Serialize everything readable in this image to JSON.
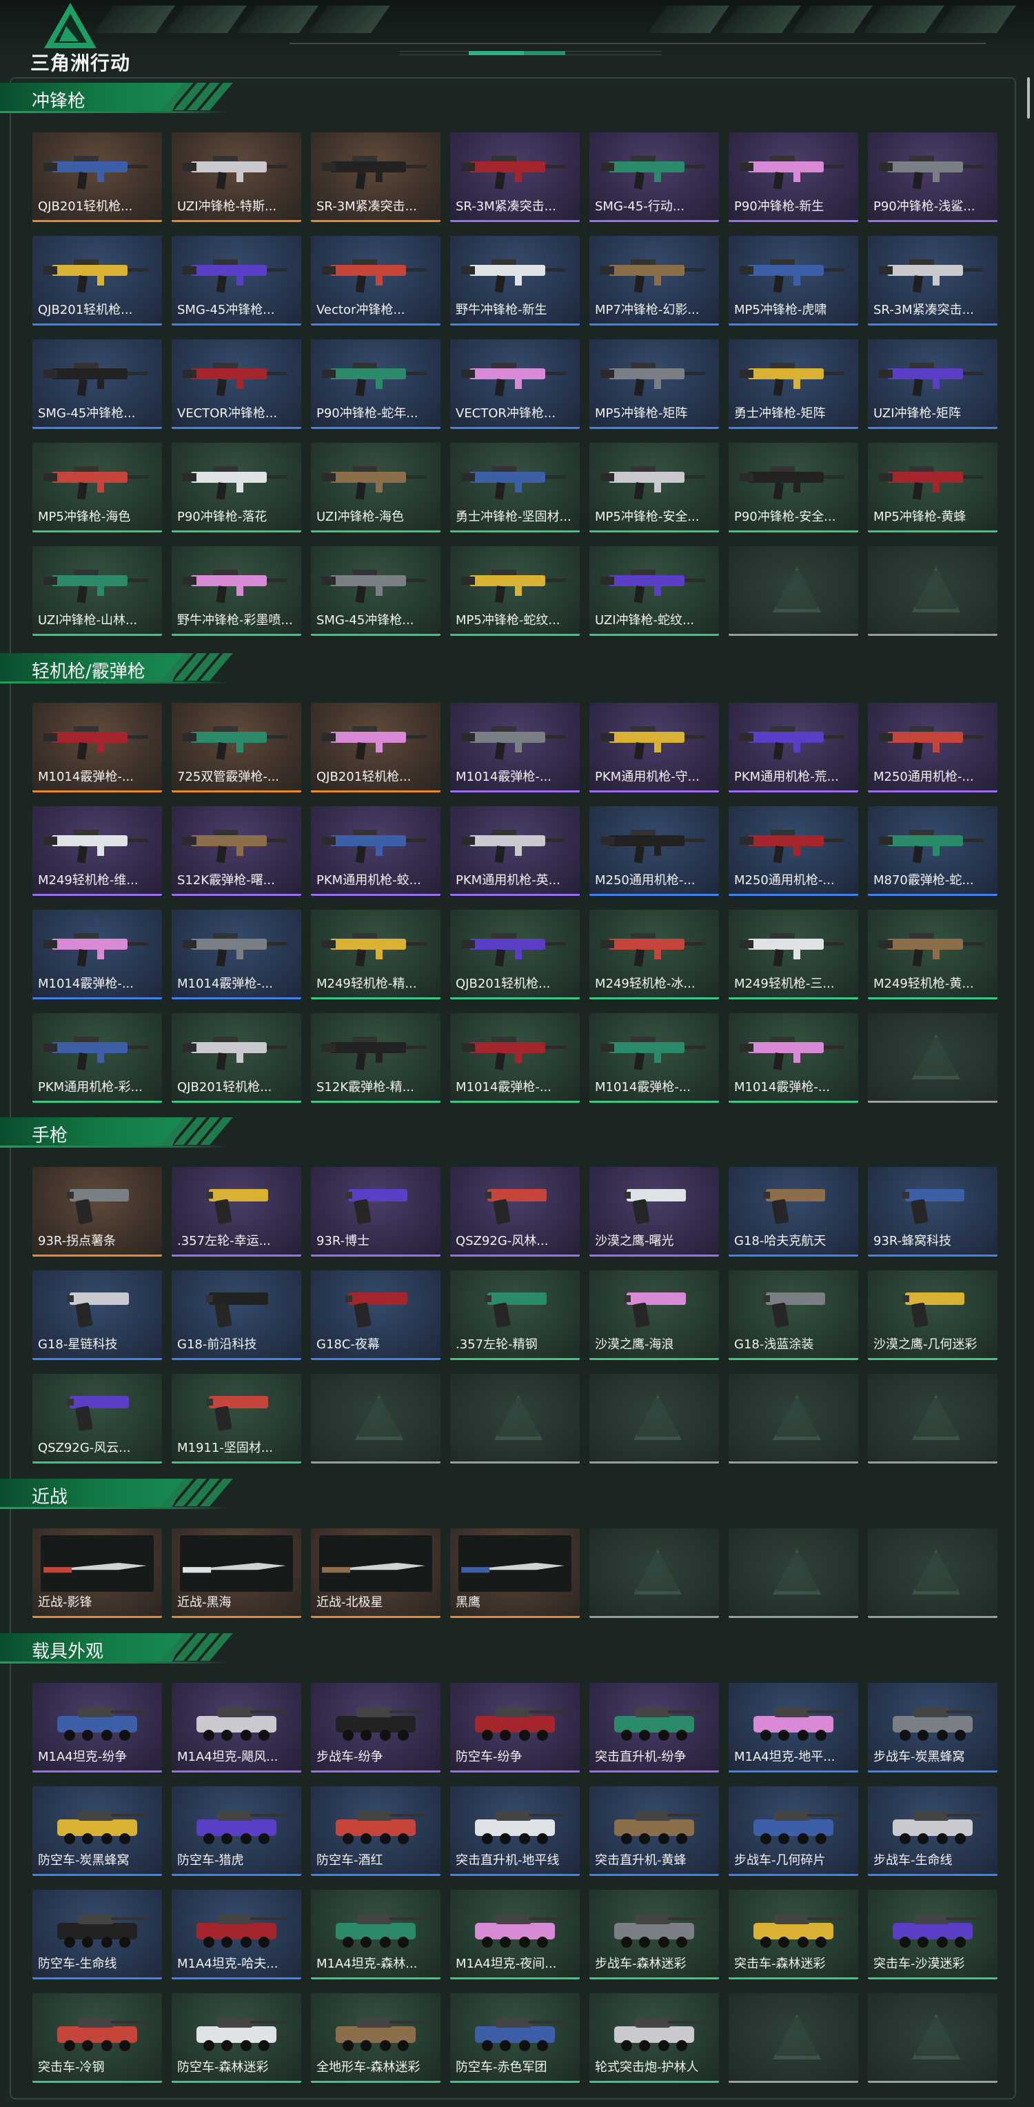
{
  "app": {
    "logo_text": "三角洲行动"
  },
  "colors": {
    "orange": "#e88a2b",
    "purple": "#9b6ef0",
    "blue": "#3f82ee",
    "green": "#38c986",
    "accent": "#1a8a52"
  },
  "sections": [
    {
      "title": "冲锋枪",
      "kind": "gun",
      "items": [
        {
          "label": "QJB201轻机枪...",
          "rarity": "orange"
        },
        {
          "label": "UZI冲锋枪-特斯...",
          "rarity": "orange"
        },
        {
          "label": "SR-3M紧凑突击...",
          "rarity": "orange"
        },
        {
          "label": "SR-3M紧凑突击...",
          "rarity": "purple"
        },
        {
          "label": "SMG-45-行动...",
          "rarity": "purple"
        },
        {
          "label": "P90冲锋枪-新生",
          "rarity": "purple"
        },
        {
          "label": "P90冲锋枪-浅鲨...",
          "rarity": "purple"
        },
        {
          "label": "QJB201轻机枪...",
          "rarity": "blue"
        },
        {
          "label": "SMG-45冲锋枪...",
          "rarity": "blue"
        },
        {
          "label": "Vector冲锋枪...",
          "rarity": "blue"
        },
        {
          "label": "野牛冲锋枪-新生",
          "rarity": "blue"
        },
        {
          "label": "MP7冲锋枪-幻影...",
          "rarity": "blue"
        },
        {
          "label": "MP5冲锋枪-虎啸",
          "rarity": "blue"
        },
        {
          "label": "SR-3M紧凑突击...",
          "rarity": "blue"
        },
        {
          "label": "SMG-45冲锋枪...",
          "rarity": "blue"
        },
        {
          "label": "VECTOR冲锋枪...",
          "rarity": "blue"
        },
        {
          "label": "P90冲锋枪-蛇年...",
          "rarity": "blue"
        },
        {
          "label": "VECTOR冲锋枪...",
          "rarity": "blue"
        },
        {
          "label": "MP5冲锋枪-矩阵",
          "rarity": "blue"
        },
        {
          "label": "勇士冲锋枪-矩阵",
          "rarity": "blue"
        },
        {
          "label": "UZI冲锋枪-矩阵",
          "rarity": "blue"
        },
        {
          "label": "MP5冲锋枪-海色",
          "rarity": "green"
        },
        {
          "label": "P90冲锋枪-落花",
          "rarity": "green"
        },
        {
          "label": "UZI冲锋枪-海色",
          "rarity": "green"
        },
        {
          "label": "勇士冲锋枪-坚固材...",
          "rarity": "green"
        },
        {
          "label": "MP5冲锋枪-安全...",
          "rarity": "green"
        },
        {
          "label": "P90冲锋枪-安全...",
          "rarity": "green"
        },
        {
          "label": "MP5冲锋枪-黄蜂",
          "rarity": "green"
        },
        {
          "label": "UZI冲锋枪-山林...",
          "rarity": "green"
        },
        {
          "label": "野牛冲锋枪-彩墨喷...",
          "rarity": "green"
        },
        {
          "label": "SMG-45冲锋枪...",
          "rarity": "green"
        },
        {
          "label": "MP5冲锋枪-蛇纹...",
          "rarity": "green"
        },
        {
          "label": "UZI冲锋枪-蛇纹...",
          "rarity": "green"
        },
        {
          "label": "",
          "rarity": "empty"
        },
        {
          "label": "",
          "rarity": "empty"
        }
      ]
    },
    {
      "title": "轻机枪/霰弹枪",
      "kind": "gun",
      "items": [
        {
          "label": "M1014霰弹枪-...",
          "rarity": "orange"
        },
        {
          "label": "725双管霰弹枪-...",
          "rarity": "orange"
        },
        {
          "label": "QJB201轻机枪...",
          "rarity": "orange"
        },
        {
          "label": "M1014霰弹枪-...",
          "rarity": "purple"
        },
        {
          "label": "PKM通用机枪-守...",
          "rarity": "purple"
        },
        {
          "label": "PKM通用机枪-荒...",
          "rarity": "purple"
        },
        {
          "label": "M250通用机枪-...",
          "rarity": "purple"
        },
        {
          "label": "M249轻机枪-维...",
          "rarity": "purple"
        },
        {
          "label": "S12K霰弹枪-曙...",
          "rarity": "purple"
        },
        {
          "label": "PKM通用机枪-蛟...",
          "rarity": "purple"
        },
        {
          "label": "PKM通用机枪-英...",
          "rarity": "purple"
        },
        {
          "label": "M250通用机枪-...",
          "rarity": "blue"
        },
        {
          "label": "M250通用机枪-...",
          "rarity": "blue"
        },
        {
          "label": "M870霰弹枪-蛇...",
          "rarity": "blue"
        },
        {
          "label": "M1014霰弹枪-...",
          "rarity": "blue"
        },
        {
          "label": "M1014霰弹枪-...",
          "rarity": "blue"
        },
        {
          "label": "M249轻机枪-精...",
          "rarity": "green"
        },
        {
          "label": "QJB201轻机枪...",
          "rarity": "green"
        },
        {
          "label": "M249轻机枪-冰...",
          "rarity": "green"
        },
        {
          "label": "M249轻机枪-三...",
          "rarity": "green"
        },
        {
          "label": "M249轻机枪-黄...",
          "rarity": "green"
        },
        {
          "label": "PKM通用机枪-彩...",
          "rarity": "green"
        },
        {
          "label": "QJB201轻机枪...",
          "rarity": "green"
        },
        {
          "label": "S12K霰弹枪-精...",
          "rarity": "green"
        },
        {
          "label": "M1014霰弹枪-...",
          "rarity": "green"
        },
        {
          "label": "M1014霰弹枪-...",
          "rarity": "green"
        },
        {
          "label": "M1014霰弹枪-...",
          "rarity": "green"
        },
        {
          "label": "",
          "rarity": "empty"
        }
      ]
    },
    {
      "title": "手枪",
      "kind": "pistol",
      "items": [
        {
          "label": "93R-拐点薯条",
          "rarity": "orange"
        },
        {
          "label": ".357左轮-幸运...",
          "rarity": "purple"
        },
        {
          "label": "93R-博士",
          "rarity": "purple"
        },
        {
          "label": "QSZ92G-风林...",
          "rarity": "purple"
        },
        {
          "label": "沙漠之鹰-曙光",
          "rarity": "purple"
        },
        {
          "label": "G18-哈夫克航天",
          "rarity": "blue"
        },
        {
          "label": "93R-蜂窝科技",
          "rarity": "blue"
        },
        {
          "label": "G18-星链科技",
          "rarity": "blue"
        },
        {
          "label": "G18-前沿科技",
          "rarity": "blue"
        },
        {
          "label": "G18C-夜幕",
          "rarity": "blue"
        },
        {
          "label": ".357左轮-精钢",
          "rarity": "green"
        },
        {
          "label": "沙漠之鹰-海浪",
          "rarity": "green"
        },
        {
          "label": "G18-浅蓝涂装",
          "rarity": "green"
        },
        {
          "label": "沙漠之鹰-几何迷彩",
          "rarity": "green"
        },
        {
          "label": "QSZ92G-风云...",
          "rarity": "green"
        },
        {
          "label": "M1911-坚固材...",
          "rarity": "green"
        },
        {
          "label": "",
          "rarity": "empty"
        },
        {
          "label": "",
          "rarity": "empty"
        },
        {
          "label": "",
          "rarity": "empty"
        },
        {
          "label": "",
          "rarity": "empty"
        },
        {
          "label": "",
          "rarity": "empty"
        }
      ]
    },
    {
      "title": "近战",
      "kind": "melee",
      "items": [
        {
          "label": "近战-影锋",
          "rarity": "orange"
        },
        {
          "label": "近战-黑海",
          "rarity": "orange"
        },
        {
          "label": "近战-北极星",
          "rarity": "orange"
        },
        {
          "label": "黑鹰",
          "rarity": "orange"
        },
        {
          "label": "",
          "rarity": "empty"
        },
        {
          "label": "",
          "rarity": "empty"
        },
        {
          "label": "",
          "rarity": "empty"
        }
      ]
    },
    {
      "title": "载具外观",
      "kind": "vehicle",
      "items": [
        {
          "label": "M1A4坦克-纷争",
          "rarity": "purple"
        },
        {
          "label": "M1A4坦克-飓风...",
          "rarity": "purple"
        },
        {
          "label": "步战车-纷争",
          "rarity": "purple"
        },
        {
          "label": "防空车-纷争",
          "rarity": "purple"
        },
        {
          "label": "突击直升机-纷争",
          "rarity": "purple"
        },
        {
          "label": "M1A4坦克-地平...",
          "rarity": "blue"
        },
        {
          "label": "步战车-炭黑蜂窝",
          "rarity": "blue"
        },
        {
          "label": "防空车-炭黑蜂窝",
          "rarity": "blue"
        },
        {
          "label": "防空车-猎虎",
          "rarity": "blue"
        },
        {
          "label": "防空车-酒红",
          "rarity": "blue"
        },
        {
          "label": "突击直升机-地平线",
          "rarity": "blue"
        },
        {
          "label": "突击直升机-黄蜂",
          "rarity": "blue"
        },
        {
          "label": "步战车-几何碎片",
          "rarity": "blue"
        },
        {
          "label": "步战车-生命线",
          "rarity": "blue"
        },
        {
          "label": "防空车-生命线",
          "rarity": "blue"
        },
        {
          "label": "M1A4坦克-哈夫...",
          "rarity": "blue"
        },
        {
          "label": "M1A4坦克-森林...",
          "rarity": "green"
        },
        {
          "label": "M1A4坦克-夜间...",
          "rarity": "green"
        },
        {
          "label": "步战车-森林迷彩",
          "rarity": "green"
        },
        {
          "label": "突击车-森林迷彩",
          "rarity": "green"
        },
        {
          "label": "突击车-沙漠迷彩",
          "rarity": "green"
        },
        {
          "label": "突击车-冷钢",
          "rarity": "green"
        },
        {
          "label": "防空车-森林迷彩",
          "rarity": "green"
        },
        {
          "label": "全地形车-森林迷彩",
          "rarity": "green"
        },
        {
          "label": "防空车-赤色军团",
          "rarity": "green"
        },
        {
          "label": "轮式突击炮-护林人",
          "rarity": "green"
        },
        {
          "label": "",
          "rarity": "empty"
        },
        {
          "label": "",
          "rarity": "empty"
        }
      ]
    }
  ]
}
